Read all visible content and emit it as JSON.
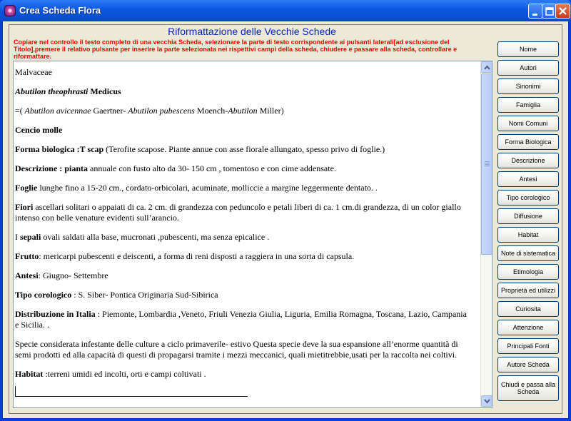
{
  "window": {
    "title": "Crea Scheda Flora",
    "icon": "flower-app-icon"
  },
  "heading": "Riformattazione delle Vecchie Schede",
  "instructions": "Copiare nel controllo il testo completo di una vecchia Scheda, selezionare la parte di testo corrispondente ai pulsanti laterali[ad esclusione del Titolo],premere il relativo pulsante per inserire la parte selezionata nei rispettivi campi della scheda, chiudere e passare alla scheda, controllare e riformattare.",
  "colors": {
    "heading": "#0b24b8",
    "instructions": "#ff0000",
    "titlebar": "#0a4fd2",
    "panel": "#ece9d8"
  },
  "editor": {
    "family": "Malvaceae",
    "species_name": "Abutilon theophrasti",
    "species_author": " Medicus",
    "synonyms": {
      "prefix": "=(",
      "s1": " Abutilon avicennae",
      "a1": " Gaertner- ",
      "s2": "Abutilon pubescens",
      "a2": " Moench-",
      "s3": "Abutilon",
      "a3": " Miller)"
    },
    "common_name": "Cencio molle",
    "forma": {
      "label": "Forma biologica :",
      "code": "T scap",
      "text": " (Terofite scapose. Piante annue con asse fiorale allungato, spesso privo di foglie.)"
    },
    "descrizione": {
      "label": "Descrizione : ",
      "word": "pianta",
      "text": " annuale con fusto alto da 30- 150 cm , tomentoso e con cime addensate."
    },
    "foglie": {
      "label": "Foglie",
      "text": " lunghe fino a 15-20 cm., cordato-orbicolari, acuminate, molliccie a margine leggermente dentato. ."
    },
    "fiori": {
      "label": "Fiori",
      "text1": " ascellari solitari o appaiati di ca. 2 cm. di grandezza con peduncolo e petali liberi di ca. 1 cm.di grandezza, di un color giallo",
      "text2": "intenso con belle venature evidenti sull’arancio."
    },
    "sepali": {
      "pre": "I ",
      "label": "sepali",
      "text": " ovali saldati alla base, mucronati ,pubescenti, ma senza epicalice ."
    },
    "frutto": {
      "label": "Frutto",
      "text": ": mericarpi pubescenti e deiscenti, a forma di reni disposti a raggiera in una sorta di capsula."
    },
    "antesi": {
      "label": "Antesi",
      "text": ": Giugno- Settembre"
    },
    "corologico": {
      "label": "Tipo corologico",
      "text": " : S. Siber- Pontica Originaria Sud-Sibirica"
    },
    "distribuzione": {
      "label": "Distribuzione in Italia",
      "text1": " : Piemonte, Lombardia ,Veneto, Friuli Venezia Giulia, Liguria, Emilia Romagna, Toscana, Lazio, Campania",
      "text2": "e Sicilia. ."
    },
    "note": {
      "text1": "Specie considerata infestante delle culture a ciclo primaverile- estivo Questa specie deve la sua espansione all’enorme quantità di",
      "text2": "semi prodotti ed alla capacità di questi di propagarsi tramite i mezzi meccanici, quali mietitrebbie,usati per la raccolta nei coltivi."
    },
    "habitat": {
      "label": "Habitat",
      "text": " :terreni umidi ed incolti, orti e campi coltivati ."
    }
  },
  "buttons": [
    "Nome",
    "Autori",
    "Sinonimi",
    "Famiglia",
    "Nomi Comuni",
    "Forma Biologica",
    "Descrizione",
    "Antesi",
    "Tipo corologico",
    "Diffusione",
    "Habitat",
    "Note di sistematica",
    "Etimologia",
    "Proprietà ed utilizzi",
    "Curiosita",
    "Attenzione",
    "Principali Fonti",
    "Autore Scheda",
    "Chiudi e passa alla Scheda"
  ]
}
